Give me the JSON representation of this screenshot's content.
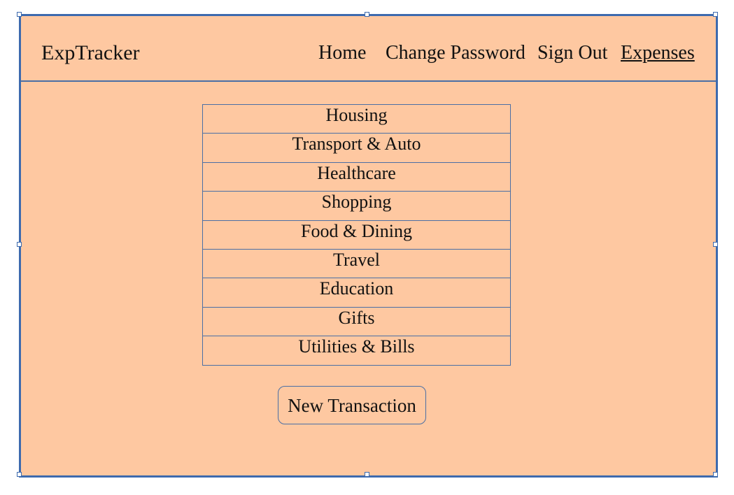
{
  "header": {
    "brand": "ExpTracker",
    "nav": {
      "home": "Home",
      "change_password": "Change Password",
      "sign_out": "Sign Out",
      "expenses": "Expenses"
    }
  },
  "categories": [
    "Housing",
    "Transport & Auto",
    "Healthcare",
    "Shopping",
    "Food & Dining",
    "Travel",
    "Education",
    "Gifts",
    "Utilities & Bills"
  ],
  "actions": {
    "new_transaction": "New Transaction"
  },
  "colors": {
    "background": "#fec8a1",
    "border": "#3d6aae"
  }
}
